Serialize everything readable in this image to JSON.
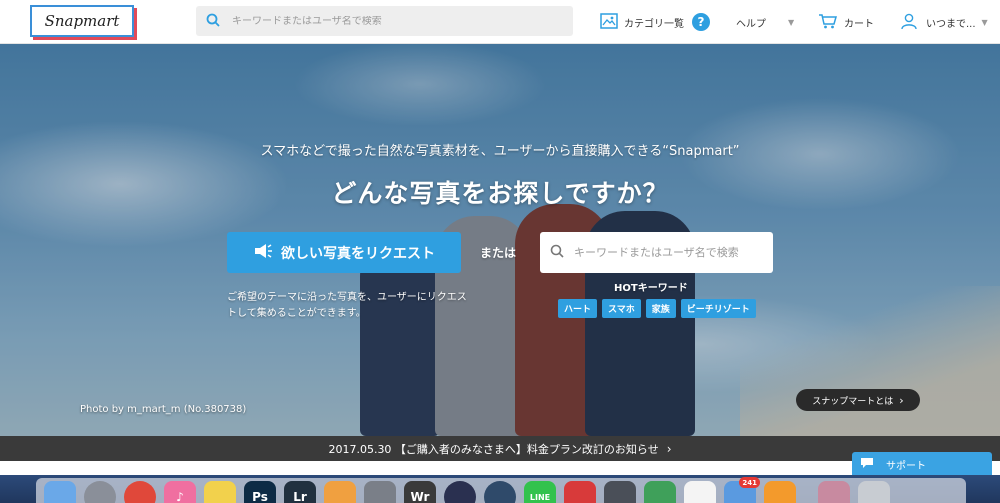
{
  "header": {
    "logo_text": "Snapmart",
    "search_placeholder": "キーワードまたはユーザ名で検索",
    "category_label": "カテゴリ一覧",
    "help_label": "ヘルプ",
    "cart_label": "カート",
    "user_label": "いつまで..."
  },
  "hero": {
    "tagline": "スマホなどで撮った自然な写真素材を、ユーザーから直接購入できる“Snapmart”",
    "headline": "どんな写真をお探しですか？",
    "request_button": "欲しい写真をリクエスト",
    "or_text": "または",
    "search_placeholder": "キーワードまたはユーザ名で検索",
    "request_description": "ご希望のテーマに沿った写真を、ユーザーにリクエストして集めることができます。",
    "hot_title": "HOTキーワード",
    "hot_keywords": [
      "ハート",
      "スマホ",
      "家族",
      "ビーチリゾート"
    ],
    "photo_credit": "Photo by m_mart_m (No.380738)",
    "about_button": "スナップマートとは"
  },
  "announcement": {
    "text": "2017.05.30 【ご購入者のみなさまへ】料金プラン改訂のお知らせ"
  },
  "support": {
    "label": "サポート"
  },
  "dock": {
    "apps": [
      {
        "name": "finder",
        "label": "",
        "color": "#6aa8e8"
      },
      {
        "name": "launchpad",
        "label": "",
        "color": "#8a8f99"
      },
      {
        "name": "chrome",
        "label": "",
        "color": "#e0483a"
      },
      {
        "name": "itunes",
        "label": "♪",
        "color": "#f06fa0"
      },
      {
        "name": "notes",
        "label": "",
        "color": "#f2d14c"
      },
      {
        "name": "photoshop",
        "label": "Ps",
        "color": "#0d2b45"
      },
      {
        "name": "lightroom",
        "label": "Lr",
        "color": "#21303f"
      },
      {
        "name": "photos",
        "label": "",
        "color": "#f0a040"
      },
      {
        "name": "system-preferences",
        "label": "",
        "color": "#7a7f88"
      },
      {
        "name": "word-app",
        "label": "Wr",
        "color": "#3a3a3a"
      },
      {
        "name": "clock",
        "label": "",
        "color": "#2a3050"
      },
      {
        "name": "time-machine",
        "label": "",
        "color": "#2f4a6a"
      },
      {
        "name": "line",
        "label": "LINE",
        "color": "#32c24d"
      },
      {
        "name": "app-red",
        "label": "",
        "color": "#d83a3a"
      },
      {
        "name": "app-tools",
        "label": "",
        "color": "#4a4f58"
      },
      {
        "name": "atom",
        "label": "",
        "color": "#3fa05a"
      },
      {
        "name": "reminders",
        "label": "",
        "color": "#f4f4f4"
      },
      {
        "name": "mail",
        "label": "",
        "color": "#5a9ae0",
        "badge": "241"
      },
      {
        "name": "app-orange",
        "label": "",
        "color": "#f39a2c"
      },
      {
        "name": "photo-thumb",
        "label": "",
        "color": "#c88aa0"
      },
      {
        "name": "trash",
        "label": "",
        "color": "#c8ccd2"
      }
    ]
  },
  "colors": {
    "accent": "#2f9fe0",
    "logo_border": "#3a8fd8",
    "logo_shadow": "#e04a5a",
    "announce_bg": "#3a3a3a"
  }
}
